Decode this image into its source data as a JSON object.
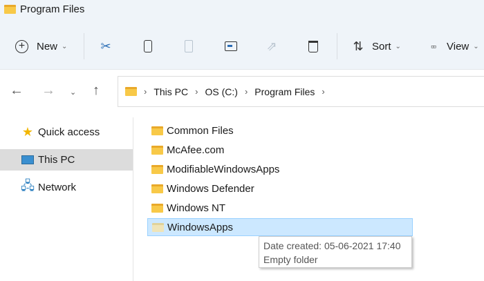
{
  "window": {
    "title": "Program Files"
  },
  "toolbar": {
    "new_label": "New",
    "sort_label": "Sort",
    "view_label": "View"
  },
  "breadcrumb": [
    "This PC",
    "OS (C:)",
    "Program Files"
  ],
  "sidebar": {
    "items": [
      {
        "label": "Quick access",
        "icon": "star-icon"
      },
      {
        "label": "This PC",
        "icon": "monitor-icon"
      },
      {
        "label": "Network",
        "icon": "network-icon"
      }
    ]
  },
  "files": [
    "Common Files",
    "McAfee.com",
    "ModifiableWindowsApps",
    "Windows Defender",
    "Windows NT",
    "WindowsApps"
  ],
  "tooltip": {
    "line1": "Date created: 05-06-2021 17:40",
    "line2": "Empty folder"
  }
}
